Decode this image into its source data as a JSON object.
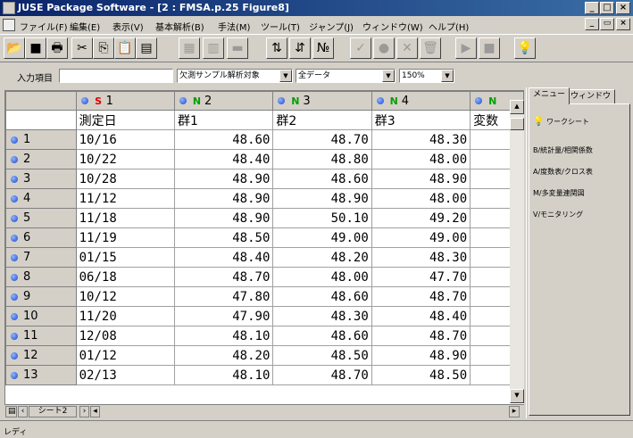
{
  "window": {
    "title": "JUSE Package Software - [2 : FMSA.p.25 Figure8]"
  },
  "title_buttons": [
    "_",
    "□",
    "×"
  ],
  "mdi_buttons": [
    "_",
    "▭",
    "×"
  ],
  "menu": [
    "ファイル(F)",
    "編集(E)",
    "表示(V)",
    "基本解析(B)",
    "手法(M)",
    "ツール(T)",
    "ジャンプ(J)",
    "ウィンドウ(W)",
    "ヘルプ(H)"
  ],
  "toolbar": {
    "open": "📂",
    "save": "■",
    "print": "🖶",
    "cut": "✂",
    "copy": "⎘",
    "paste": "📋",
    "paste_special": "▤",
    "insert_row": "▦",
    "insert_col": "▥",
    "delete": "▬",
    "sort_asc": "⇅",
    "sort_desc": "⇵",
    "number": "№",
    "check": "✓",
    "circle": "●",
    "cross": "✕",
    "trash": "🗑",
    "play": "▶",
    "stop": "■",
    "light": "💡"
  },
  "inputbar": {
    "label": "入力項目",
    "value": "",
    "missing": "欠測サンプル解析対象",
    "subset": "全データ",
    "zoom": "150%"
  },
  "grid": {
    "col_headers": [
      {
        "tag": "S",
        "num": "1"
      },
      {
        "tag": "N",
        "num": "2"
      },
      {
        "tag": "N",
        "num": "3"
      },
      {
        "tag": "N",
        "num": "4"
      },
      {
        "tag": "N",
        "num": ""
      }
    ],
    "var_names": [
      "測定日",
      "群1",
      "群2",
      "群3",
      "変数"
    ],
    "rows": [
      {
        "n": "1",
        "date": "10/16",
        "v": [
          "48.60",
          "48.70",
          "48.30"
        ]
      },
      {
        "n": "2",
        "date": "10/22",
        "v": [
          "48.40",
          "48.80",
          "48.00"
        ]
      },
      {
        "n": "3",
        "date": "10/28",
        "v": [
          "48.90",
          "48.60",
          "48.90"
        ]
      },
      {
        "n": "4",
        "date": "11/12",
        "v": [
          "48.90",
          "48.90",
          "48.00"
        ]
      },
      {
        "n": "5",
        "date": "11/18",
        "v": [
          "48.90",
          "50.10",
          "49.20"
        ]
      },
      {
        "n": "6",
        "date": "11/19",
        "v": [
          "48.50",
          "49.00",
          "49.00"
        ]
      },
      {
        "n": "7",
        "date": "01/15",
        "v": [
          "48.40",
          "48.20",
          "48.30"
        ]
      },
      {
        "n": "8",
        "date": "06/18",
        "v": [
          "48.70",
          "48.00",
          "47.70"
        ]
      },
      {
        "n": "9",
        "date": "10/12",
        "v": [
          "47.80",
          "48.60",
          "48.70"
        ]
      },
      {
        "n": "10",
        "date": "11/20",
        "v": [
          "47.90",
          "48.30",
          "48.40"
        ]
      },
      {
        "n": "11",
        "date": "12/08",
        "v": [
          "48.10",
          "48.60",
          "48.70"
        ]
      },
      {
        "n": "12",
        "date": "01/12",
        "v": [
          "48.20",
          "48.50",
          "48.90"
        ]
      },
      {
        "n": "13",
        "date": "02/13",
        "v": [
          "48.10",
          "48.70",
          "48.50"
        ]
      }
    ]
  },
  "sheet_tab": "シート2",
  "side_panel": {
    "tabs": [
      "メニュー",
      "ウィンドウ"
    ],
    "items": [
      "ワークシート",
      "B/統計量/相関係数",
      "A/度数表/クロス表",
      "M/多変量連関図",
      "V/モニタリング"
    ]
  },
  "status": "レディ"
}
